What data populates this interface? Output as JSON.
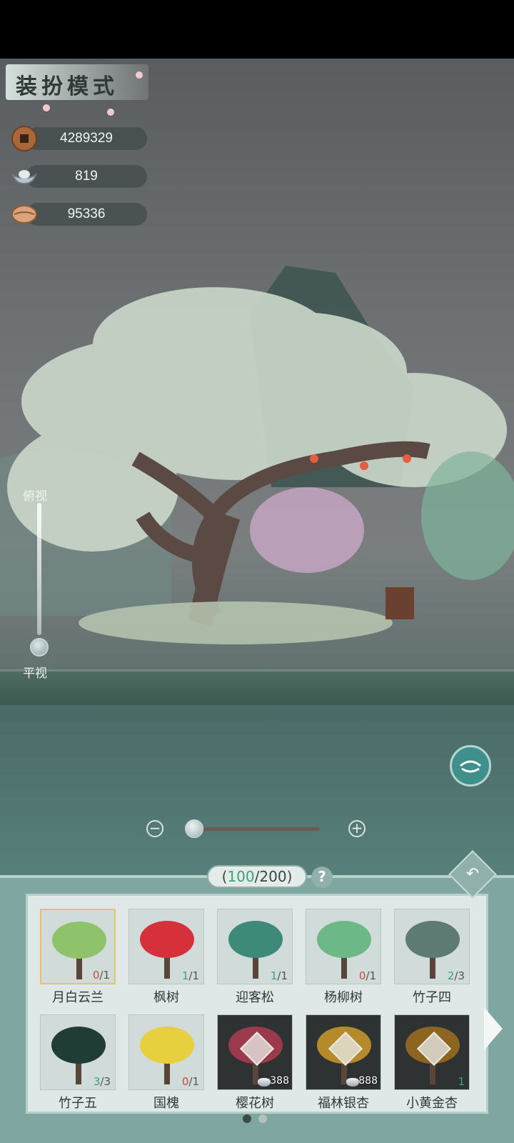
{
  "header": {
    "mode_title": "装扮模式"
  },
  "currencies": [
    {
      "name": "copper-coin",
      "value": "4289329"
    },
    {
      "name": "silver-ingot",
      "value": "819"
    },
    {
      "name": "shell",
      "value": "95336"
    }
  ],
  "camera": {
    "top_label": "俯视",
    "bottom_label": "平视"
  },
  "inventory": {
    "used": "100",
    "separator": "/",
    "capacity": "200",
    "help": "?",
    "page_count": 2,
    "active_page": 1,
    "items": [
      {
        "name": "月白云兰",
        "have": "0",
        "max": "1",
        "selected": true,
        "art_color": "#8ec26b"
      },
      {
        "name": "枫树",
        "have": "1",
        "max": "1",
        "art_color": "#d6303a"
      },
      {
        "name": "迎客松",
        "have": "1",
        "max": "1",
        "art_color": "#3e8a78"
      },
      {
        "name": "杨柳树",
        "have": "0",
        "max": "1",
        "art_color": "#6cb886"
      },
      {
        "name": "竹子四",
        "have": "2",
        "max": "3",
        "art_color": "#5e7a74"
      },
      {
        "name": "竹子五",
        "have": "3",
        "max": "3",
        "art_color": "#1f3d36"
      },
      {
        "name": "国槐",
        "have": "0",
        "max": "1",
        "art_color": "#e7cf3e"
      },
      {
        "name": "樱花树",
        "price": "388",
        "locked": true,
        "art_color": "#9c3a4d"
      },
      {
        "name": "福林银杏",
        "price": "888",
        "locked": true,
        "art_color": "#b58a2a"
      },
      {
        "name": "小黄金杏",
        "have": "1",
        "locked": true,
        "art_color": "#8d6420"
      }
    ]
  },
  "colors": {
    "accent_teal": "#3f8f8c",
    "count_zero": "#c9483f",
    "count_owned": "#3f9f7a"
  }
}
